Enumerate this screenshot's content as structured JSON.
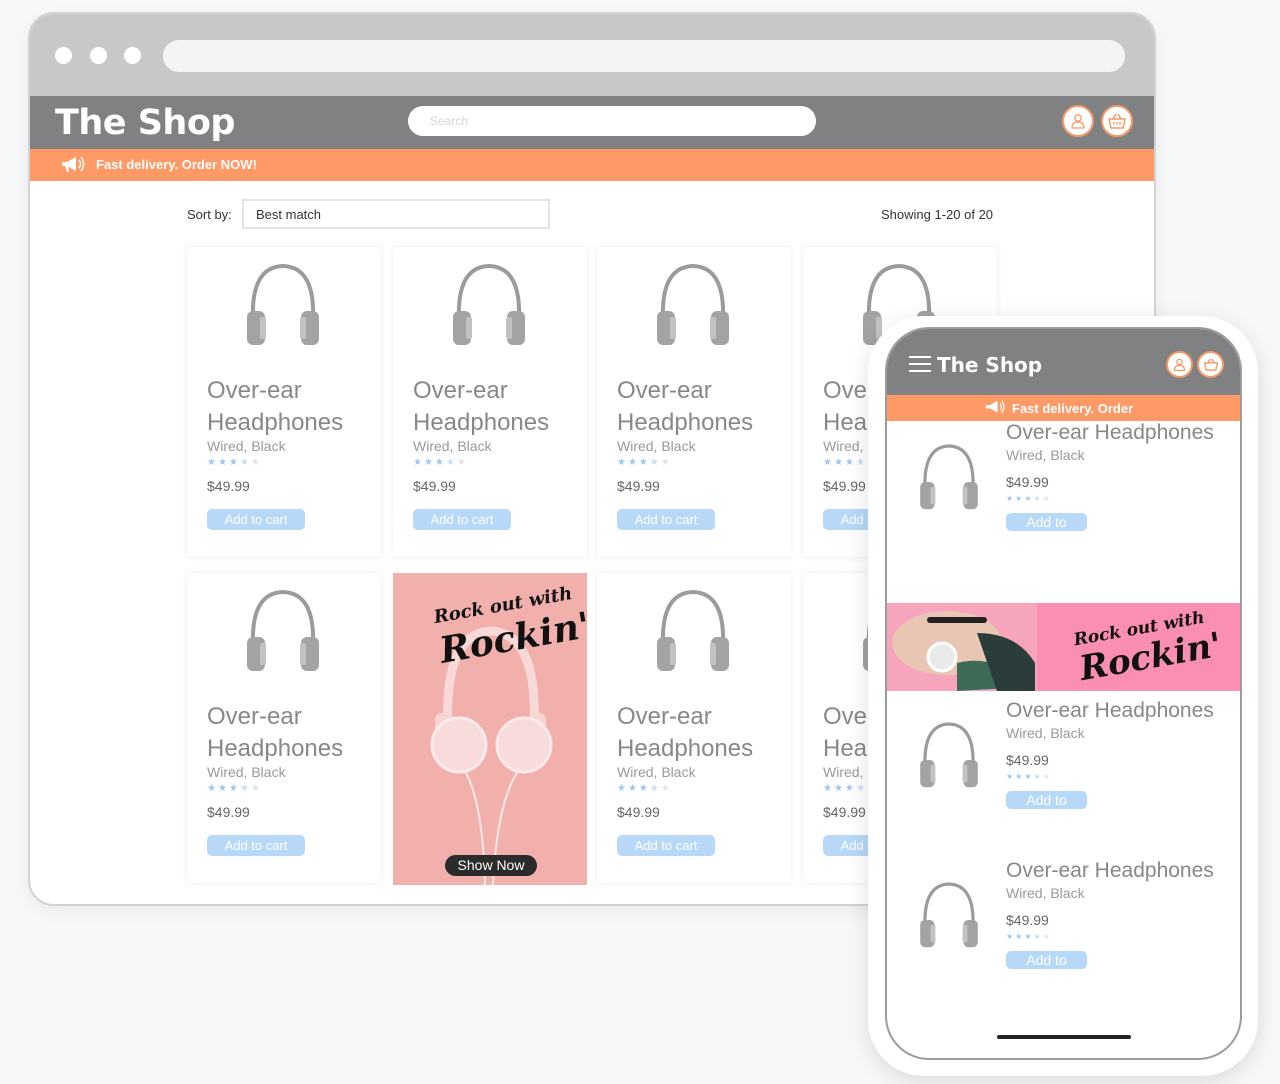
{
  "desktop": {
    "brand": "The Shop",
    "search_placeholder": "Search",
    "promo_text": "Fast delivery. Order NOW!",
    "sort_label": "Sort by:",
    "sort_value": "Best match",
    "showing": "Showing 1-20 of 20",
    "products": [
      {
        "name": "Over-ear Headphones",
        "variant": "Wired, Black",
        "price": "$49.99",
        "rating": 3.5,
        "button": "Add to cart"
      },
      {
        "name": "Over-ear Headphones",
        "variant": "Wired, Black",
        "price": "$49.99",
        "rating": 3.5,
        "button": "Add to cart"
      },
      {
        "name": "Over-ear Headphones",
        "variant": "Wired, Black",
        "price": "$49.99",
        "rating": 3.5,
        "button": "Add to cart"
      },
      {
        "name": "Over-ear Headphones",
        "variant": "Wired, Black",
        "price": "$49.99",
        "rating": 3.5,
        "button": "Add to cart"
      },
      {
        "name": "Over-ear Headphones",
        "variant": "Wired, Black",
        "price": "$49.99",
        "rating": 3.5,
        "button": "Add to cart"
      },
      {
        "name": "Over-ear Headphones",
        "variant": "Wired, Black",
        "price": "$49.99",
        "rating": 3.5,
        "button": "Add to cart"
      },
      {
        "name": "Over-ear Headphones",
        "variant": "Wired, Black",
        "price": "$49.99",
        "rating": 3.5,
        "button": "Add to cart"
      }
    ],
    "ad": {
      "line1": "Rock out with",
      "line2": "Rockin'",
      "button": "Show Now"
    }
  },
  "mobile": {
    "brand": "The Shop",
    "promo_text": "Fast delivery. Order",
    "products": [
      {
        "name": "Over-ear Headphones",
        "variant": "Wired, Black",
        "price": "$49.99",
        "rating": 3.5,
        "button": "Add to"
      },
      {
        "name": "Over-ear Headphones",
        "variant": "Wired, Black",
        "price": "$49.99",
        "rating": 3.5,
        "button": "Add to"
      },
      {
        "name": "Over-ear Headphones",
        "variant": "Wired, Black",
        "price": "$49.99",
        "rating": 3.5,
        "button": "Add to"
      }
    ],
    "ad": {
      "line1": "Rock out with",
      "line2": "Rockin'"
    }
  },
  "icons": {
    "user": "user-icon",
    "cart": "basket-icon",
    "promo": "megaphone-icon",
    "menu": "hamburger-icon",
    "product": "headphones-icon"
  },
  "colors": {
    "header": "#7f8183",
    "promo": "#ff9966",
    "accent_button": "#b7d8f7",
    "ad_background": "#f1b0ac",
    "mobile_ad_background": "#fa8fb1"
  }
}
